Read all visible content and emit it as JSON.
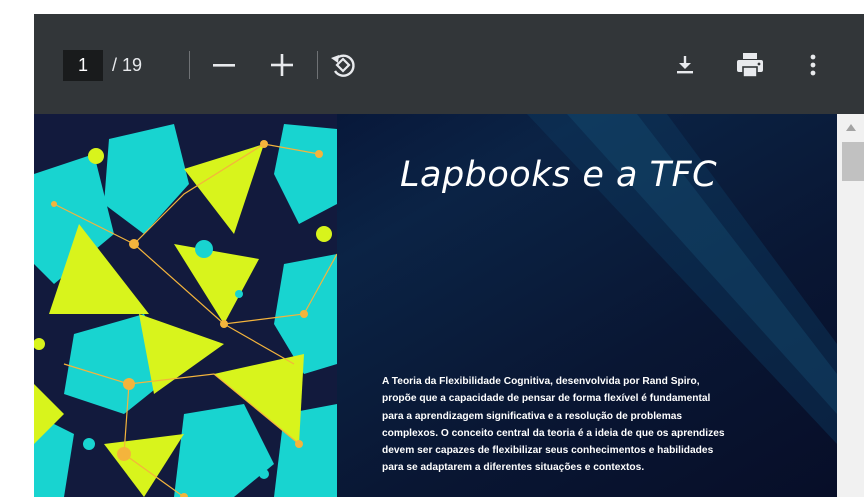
{
  "toolbar": {
    "current_page": "1",
    "page_total": "/ 19",
    "icons": {
      "zoom_out": "minus-icon",
      "zoom_in": "plus-icon",
      "rotate": "rotate-icon",
      "download": "download-icon",
      "print": "print-icon",
      "more": "more-vert-icon"
    }
  },
  "document": {
    "title": "Lapbooks e a TFC",
    "paragraph_lines": [
      "A Teoria da Flexibilidade Cognitiva, desenvolvida por Rand Spiro,",
      "propõe que a capacidade de pensar de forma flexível é fundamental",
      "para a aprendizagem significativa e a resolução de problemas",
      "complexos. O conceito central da teoria é a ideia de que os aprendizes",
      "devem ser capazes de flexibilizar seus conhecimentos e habilidades",
      "para se adaptarem a diferentes situações e contextos."
    ]
  },
  "colors": {
    "toolbar": "#323639",
    "art_background": "#121a3d",
    "shape_lime": "#d8f41c",
    "shape_teal": "#18d4d0",
    "node_orange": "#f4b43c"
  }
}
